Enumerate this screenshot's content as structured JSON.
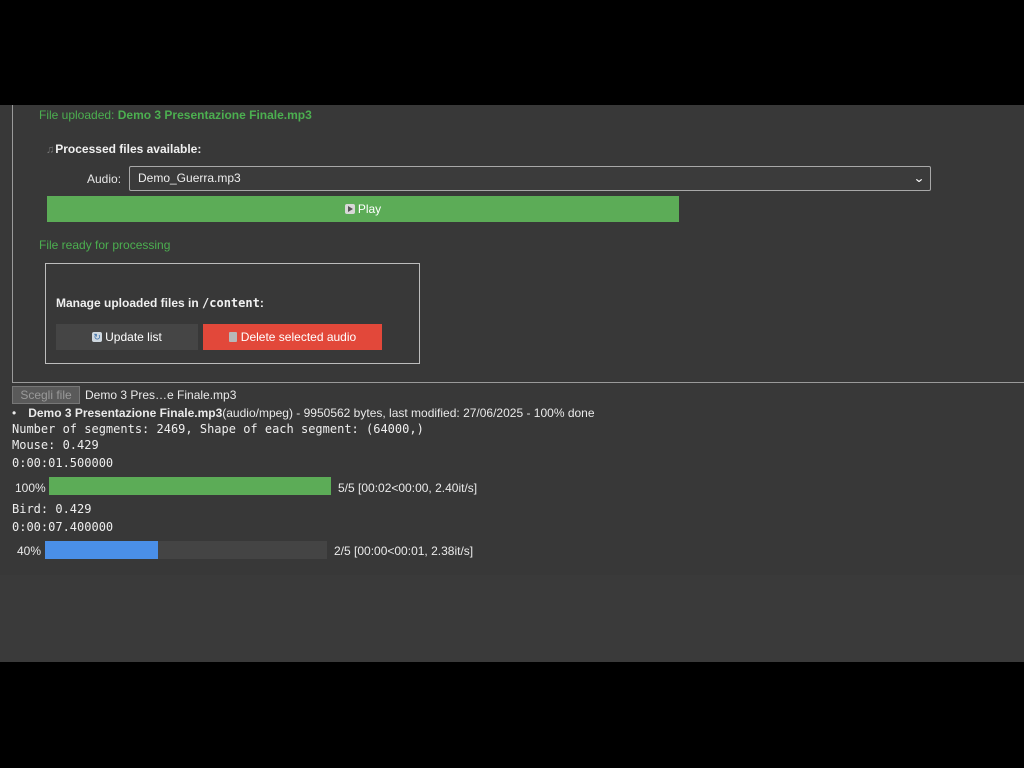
{
  "upload": {
    "status_prefix": "File uploaded: ",
    "status_file": "Demo 3 Presentazione Finale.mp3"
  },
  "processed": {
    "icon": "music-note-icon",
    "label": "Processed files available:",
    "audio_label": "Audio:",
    "audio_selected": "Demo_Guerra.mp3",
    "play_label": "Play",
    "ready_status": "File ready for processing"
  },
  "manage": {
    "title_prefix": "Manage uploaded files in ",
    "title_path": "/content",
    "title_suffix": ":",
    "update_label": "Update list",
    "delete_label": "Delete selected audio"
  },
  "file_input": {
    "button_label": "Scegli file",
    "chosen_name": "Demo 3 Pres…e Finale.mp3"
  },
  "file_info": {
    "name": "Demo 3 Presentazione Finale.mp3",
    "details": "(audio/mpeg) - 9950562 bytes, last modified: 27/06/2025 - 100% done"
  },
  "output": {
    "segments_line": "Number of segments: 2469, Shape of each segment: (64000,)",
    "detections": [
      {
        "label_line": "Mouse: 0.429",
        "time_line": "0:00:01.500000",
        "percent_label": "100%",
        "progress": 1.0,
        "color": "#5cac57",
        "info": "5/5 [00:02<00:00,  2.40it/s]"
      },
      {
        "label_line": "Bird: 0.429",
        "time_line": "0:00:07.400000",
        "percent_label": "40%",
        "progress": 0.4,
        "color": "#4a8fe8",
        "info": "2/5 [00:00<00:01,  2.38it/s]"
      }
    ]
  },
  "colors": {
    "success_green": "#4caf50",
    "play_green": "#5cac57",
    "delete_red": "#e2483a",
    "progress_blue": "#4a8fe8"
  }
}
